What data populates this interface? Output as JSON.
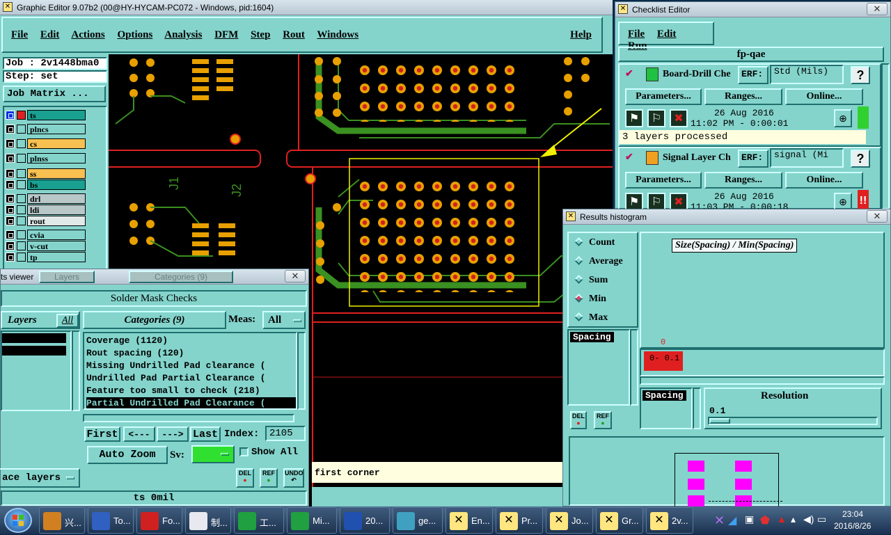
{
  "main_window": {
    "title": "Graphic Editor 9.07b2 (00@HY-HYCAM-PC072 - Windows, pid:1604)",
    "menu": [
      "File",
      "Edit",
      "Actions",
      "Options",
      "Analysis",
      "DFM",
      "Step",
      "Rout",
      "Windows"
    ],
    "help": "Help",
    "job_label": "Job : 2v1448bma0",
    "step_label": "Step: set",
    "job_matrix_button": "Job Matrix ...",
    "layers": [
      {
        "name": "ts",
        "color": "#1aa090"
      },
      {
        "name": "plncs",
        "color": "#84d4cc"
      },
      {
        "name": "cs",
        "color": "#f8c050"
      },
      {
        "name": "plnss",
        "color": "#84d4cc"
      },
      {
        "name": "ss",
        "color": "#f8c050"
      },
      {
        "name": "bs",
        "color": "#1aa090"
      },
      {
        "name": "drl",
        "color": "#b8c8c8"
      },
      {
        "name": "ldi",
        "color": "#b8c8c8"
      },
      {
        "name": "rout",
        "color": "#e0e8e8"
      },
      {
        "name": "cvia",
        "color": "#84d4cc"
      },
      {
        "name": "v-cut",
        "color": "#84d4cc"
      },
      {
        "name": "tp",
        "color": "#84d4cc"
      }
    ],
    "canvas_labels": [
      "J1",
      "J2"
    ],
    "status_prompt": "first corner"
  },
  "results_viewer": {
    "title": "ts viewer",
    "tabs": [
      "Layers",
      "Categories (9)"
    ],
    "header": "Solder Mask Checks",
    "layers_label": "Layers",
    "layers_all": "All",
    "categories_label": "Categories (9)",
    "meas_label": "Meas:",
    "meas_value": "All",
    "categories": [
      "Coverage (1120)",
      "Rout spacing (120)",
      "Missing Undrilled Pad clearance (",
      "Undrilled Pad Partial Clearance (",
      "Feature too small to check (218)",
      "Partial Undrilled Pad Clearance ("
    ],
    "nav": {
      "first": "First",
      "prev": "<---",
      "next": "--->",
      "last": "Last",
      "index_label": "Index:",
      "index_value": "2105"
    },
    "auto_zoom": "Auto Zoom",
    "sv_label": "Sv:",
    "show_all": "Show All",
    "surface_layers": "ace layers",
    "btn_del": "DEL",
    "btn_ref": "REF",
    "btn_undo": "UNDO",
    "footer": "ts 0mil"
  },
  "checklist_editor": {
    "title": "Checklist Editor",
    "menu": [
      "File",
      "Edit",
      "Run"
    ],
    "checklist_name": "fp-qae",
    "erf_label": "ERF:",
    "checks": [
      {
        "name": "Board-Drill Che",
        "erf": "Std (Mils)",
        "date": "26 Aug 2016",
        "time": "11:02 PM - 0:00:01",
        "status": "3 layers processed",
        "status_color": "#30d030"
      },
      {
        "name": "Signal Layer Ch",
        "erf": "signal (Mi",
        "date": "26 Aug 2016",
        "time": "11:03 PM - 0:00:18",
        "status": "",
        "status_color": "#e02020"
      }
    ],
    "buttons": [
      "Parameters...",
      "Ranges...",
      "Online..."
    ],
    "help": "?"
  },
  "histogram": {
    "title": "Results histogram",
    "options": [
      {
        "label": "Count",
        "selected": false
      },
      {
        "label": "Average",
        "selected": false
      },
      {
        "label": "Sum",
        "selected": false
      },
      {
        "label": "Min",
        "selected": true
      },
      {
        "label": "Max",
        "selected": false
      }
    ],
    "chart_title": "Size(Spacing) / Min(Spacing)",
    "bar_value": "0",
    "bar_label": "0- 0.1",
    "list_item": "Spacing",
    "resolution_label": "Resolution",
    "resolution_value": "0.1",
    "list_item_2": "Spacing",
    "btn_del": "DEL",
    "btn_ref": "REF"
  },
  "taskbar": {
    "items": [
      {
        "label": "兴...",
        "color": "#d08020"
      },
      {
        "label": "To...",
        "color": "#3060c0"
      },
      {
        "label": "Fo...",
        "color": "#d02020"
      },
      {
        "label": "制...",
        "color": "#e8e8f0"
      },
      {
        "label": "工...",
        "color": "#20a040"
      },
      {
        "label": "Mi...",
        "color": "#20a040"
      },
      {
        "label": "20...",
        "color": "#2050b0"
      },
      {
        "label": "ge...",
        "color": "#40a0c0"
      },
      {
        "label": "En...",
        "color": "#ffe680"
      },
      {
        "label": "Pr...",
        "color": "#ffe680"
      },
      {
        "label": "Jo...",
        "color": "#ffe680"
      },
      {
        "label": "Gr...",
        "color": "#ffe680"
      },
      {
        "label": "2v...",
        "color": "#ffe680"
      }
    ],
    "time": "23:04",
    "date": "2016/8/26"
  }
}
